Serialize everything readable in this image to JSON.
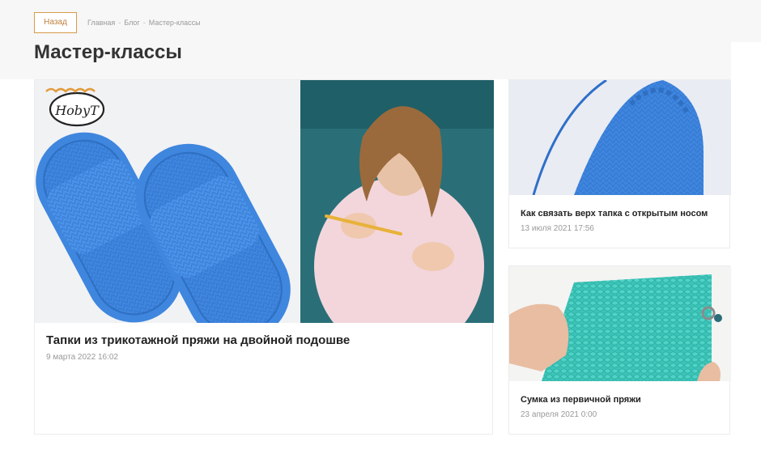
{
  "header": {
    "back_label": "Назад",
    "breadcrumb": [
      "Главная",
      "Блог",
      "Мастер-классы"
    ],
    "breadcrumb_separator": "-",
    "page_title": "Мастер-классы"
  },
  "articles": [
    {
      "title": "Тапки из трикотажной пряжи на двойной подошве",
      "date": "9 марта 2022 16:02",
      "logo_text": "HobyT"
    },
    {
      "title": "Как связать верх тапка с открытым носом",
      "date": "13 июля 2021 17:56"
    },
    {
      "title": "Сумка из первичной пряжи",
      "date": "23 апреля 2021 0:00"
    }
  ],
  "colors": {
    "accent": "#d89a4a",
    "yarn_blue": "#4a90e2",
    "yarn_teal": "#3cc4b8"
  }
}
